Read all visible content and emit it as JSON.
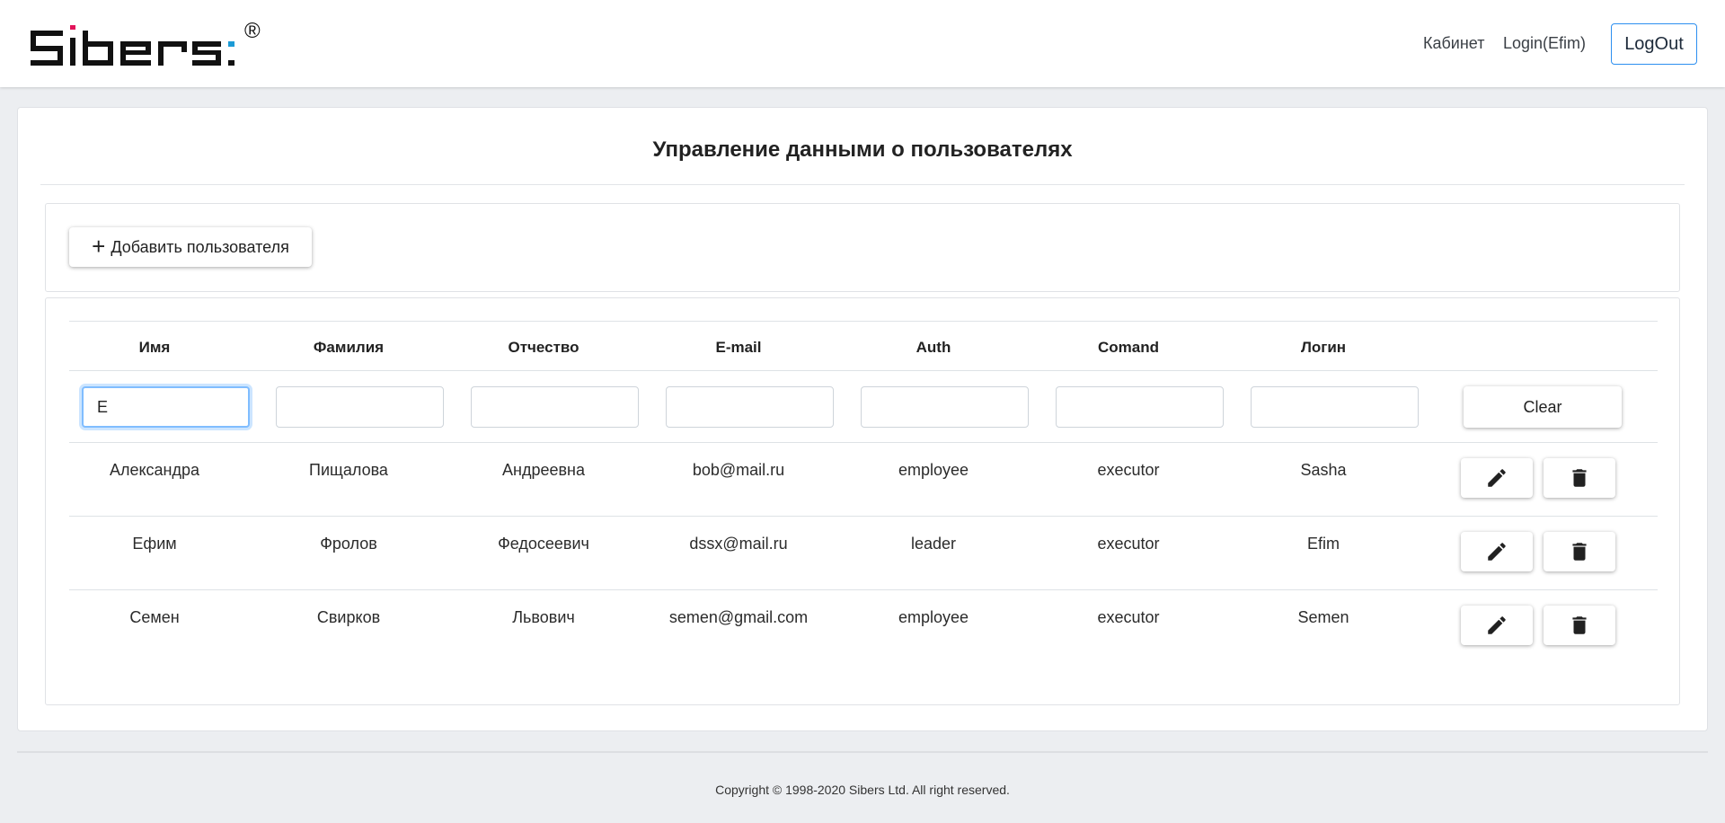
{
  "header": {
    "brand": "Sibers",
    "registered_mark": "®",
    "nav": {
      "cabinet": "Кабинет",
      "login": "Login(Efim)",
      "logout": "LogOut"
    }
  },
  "main": {
    "title": "Управление данными о пользователях",
    "add_user_label": "Добавить пользователя",
    "table": {
      "columns": [
        "Имя",
        "Фамилия",
        "Отчество",
        "E-mail",
        "Auth",
        "Comand",
        "Логин"
      ],
      "filters": [
        "E",
        "",
        "",
        "",
        "",
        "",
        ""
      ],
      "clear_label": "Clear",
      "rows": [
        [
          "Александра",
          "Пищалова",
          "Андреевна",
          "bob@mail.ru",
          "employee",
          "executor",
          "Sasha"
        ],
        [
          "Ефим",
          "Фролов",
          "Федосеевич",
          "dssx@mail.ru",
          "leader",
          "executor",
          "Efim"
        ],
        [
          "Семен",
          "Свирков",
          "Львович",
          "semen@gmail.com",
          "employee",
          "executor",
          "Semen"
        ]
      ]
    }
  },
  "footer": {
    "copyright": "Copyright © 1998-2020 Sibers Ltd. All right reserved."
  },
  "colors": {
    "page_bg": "#eceef1",
    "accent": "#2d8ff0",
    "logo_black": "#111111",
    "logo_pink": "#e2145a",
    "logo_blue": "#1c9bd6"
  },
  "icons": {
    "add": "plus-icon",
    "edit": "pencil-icon",
    "delete": "trash-icon"
  }
}
